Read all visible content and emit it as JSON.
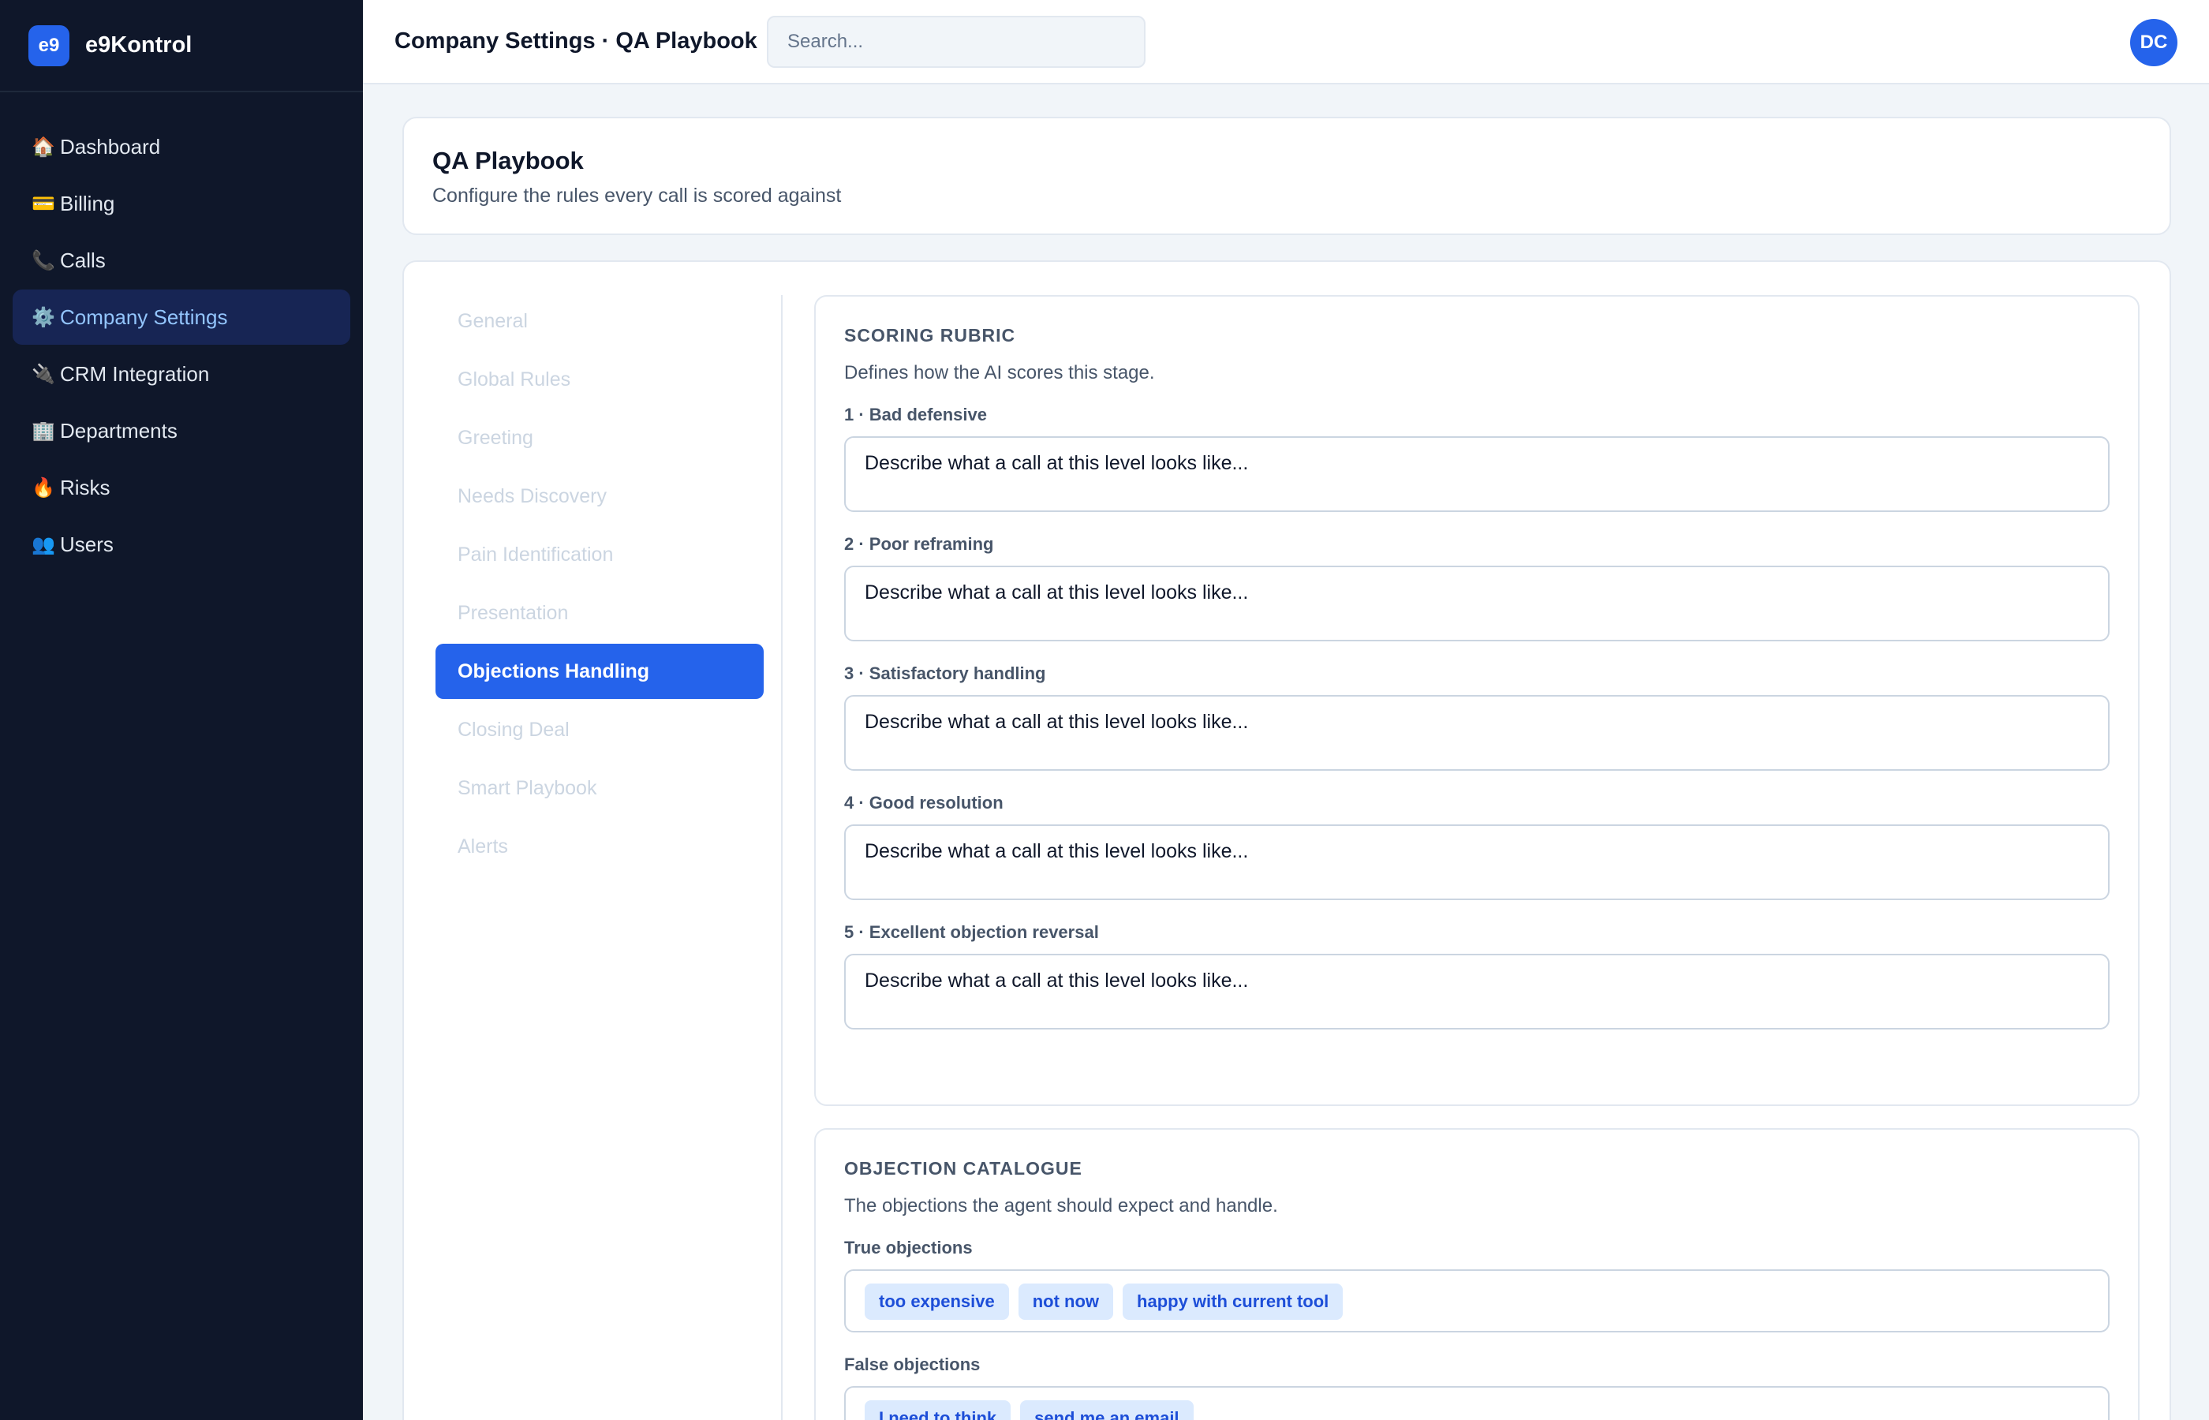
{
  "brand": {
    "logo": "e9",
    "name": "e9Kontrol"
  },
  "sidebar": {
    "items": [
      {
        "icon": "🏠",
        "icon_name": "house-icon",
        "label": "Dashboard"
      },
      {
        "icon": "💳",
        "icon_name": "credit-card-icon",
        "label": "Billing"
      },
      {
        "icon": "📞",
        "icon_name": "phone-icon",
        "label": "Calls"
      },
      {
        "icon": "⚙️",
        "icon_name": "gear-icon",
        "label": "Company Settings",
        "active": true
      },
      {
        "icon": "🔌",
        "icon_name": "plug-icon",
        "label": "CRM Integration"
      },
      {
        "icon": "🏢",
        "icon_name": "building-icon",
        "label": "Departments"
      },
      {
        "icon": "🔥",
        "icon_name": "fire-icon",
        "label": "Risks"
      },
      {
        "icon": "👥",
        "icon_name": "users-icon",
        "label": "Users"
      }
    ]
  },
  "topbar": {
    "title": "Company Settings · QA Playbook",
    "search_placeholder": "Search...",
    "avatar": "DC"
  },
  "header": {
    "title": "QA Playbook",
    "subtitle": "Configure the rules every call is scored against"
  },
  "stages": [
    "General",
    "Global Rules",
    "Greeting",
    "Needs Discovery",
    "Pain Identification",
    "Presentation",
    "Objections Handling",
    "Closing Deal",
    "Smart Playbook",
    "Alerts"
  ],
  "active_stage": "Objections Handling",
  "rubric": {
    "title": "SCORING RUBRIC",
    "description": "Defines how the AI scores this stage.",
    "levels": [
      {
        "label": "1 · Bad defensive",
        "placeholder": "Describe what a call at this level looks like..."
      },
      {
        "label": "2 · Poor reframing",
        "placeholder": "Describe what a call at this level looks like..."
      },
      {
        "label": "3 · Satisfactory handling",
        "placeholder": "Describe what a call at this level looks like..."
      },
      {
        "label": "4 · Good resolution",
        "placeholder": "Describe what a call at this level looks like..."
      },
      {
        "label": "5 · Excellent objection reversal",
        "placeholder": "Describe what a call at this level looks like..."
      }
    ]
  },
  "catalogue": {
    "title": "OBJECTION CATALOGUE",
    "description": "The objections the agent should expect and handle.",
    "true_label": "True objections",
    "true_objections": [
      "too expensive",
      "not now",
      "happy with current tool"
    ],
    "false_label": "False objections",
    "false_objections": [
      "I need to think",
      "send me an email"
    ]
  },
  "colors": {
    "sidebar_bg": "#0f172a",
    "accent": "#2563eb",
    "active_nav_bg": "#172554",
    "chip_bg": "#dbeafe",
    "chip_text": "#1d4ed8"
  }
}
